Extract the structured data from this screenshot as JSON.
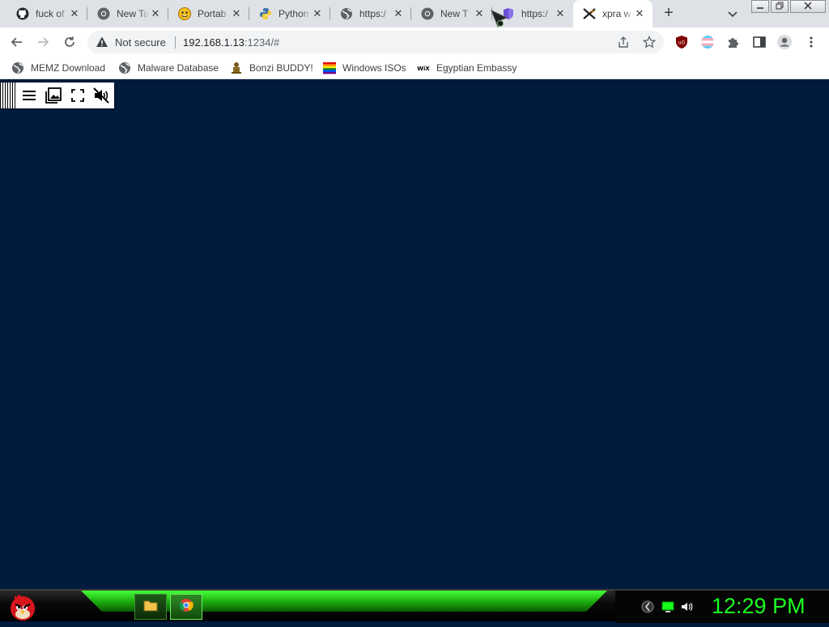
{
  "tabs": [
    {
      "title": "fuck of",
      "favicon": "github-icon"
    },
    {
      "title": "New Ta",
      "favicon": "chrome-icon"
    },
    {
      "title": "Portab",
      "favicon": "emoji-face-icon"
    },
    {
      "title": "Python",
      "favicon": "python-icon"
    },
    {
      "title": "https:/",
      "favicon": "globe-icon"
    },
    {
      "title": "New T",
      "favicon": "chrome-icon"
    },
    {
      "title": "https:/",
      "favicon": "shield-purple-icon"
    },
    {
      "title": "xpra w",
      "favicon": "xpra-icon",
      "active": true
    }
  ],
  "omnibox": {
    "security_label": "Not secure",
    "url_host": "192.168.1.13",
    "url_rest": ":1234/#"
  },
  "bookmarks": [
    {
      "label": "MEMZ Download",
      "icon": "globe-icon"
    },
    {
      "label": "Malware Database",
      "icon": "globe-icon"
    },
    {
      "label": "Bonzi BUDDY!",
      "icon": "bonzi-icon"
    },
    {
      "label": "Windows ISOs",
      "icon": "rainbow-flag-icon"
    },
    {
      "label": "Egyptian Embassy",
      "icon": "wix-icon"
    }
  ],
  "taskbar": {
    "clock": "12:29 PM"
  },
  "colors": {
    "desktop_bg": "#001b3d",
    "tabstrip_bg": "#dee1e6",
    "clock_green": "#1dff22",
    "taskbar_glow": "#46ff3a"
  }
}
